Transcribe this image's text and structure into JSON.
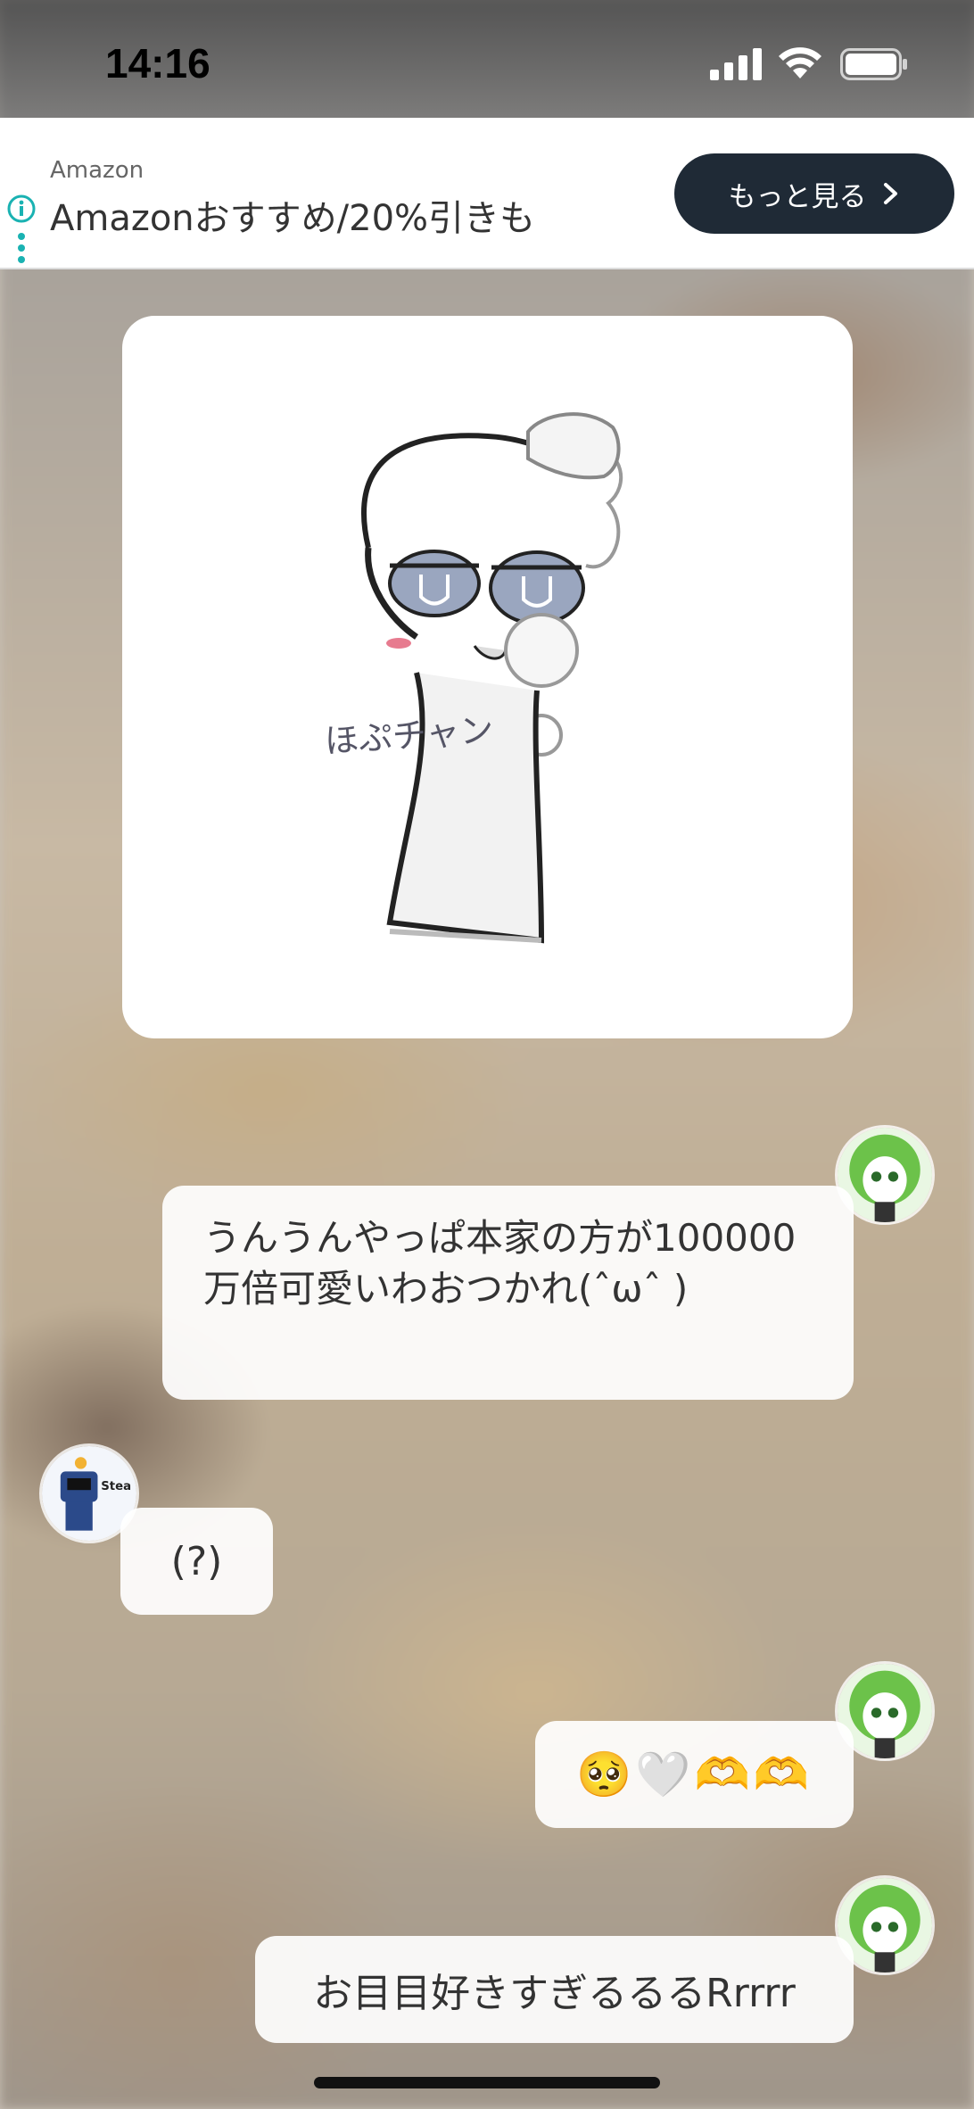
{
  "status_bar": {
    "time": "14:16"
  },
  "ad": {
    "sponsor": "Amazon",
    "title": "Amazonおすすめ/20%引きも",
    "cta_label": "もっと見る"
  },
  "image_card": {
    "handwritten_text": "ほぷチャン"
  },
  "messages": [
    {
      "side": "right",
      "text": "うんうんやっぱ本家の方が100000万倍可愛いわおつかれ(ˆωˆ )"
    },
    {
      "side": "left",
      "text": "(?)",
      "avatar_text": "Stea"
    },
    {
      "side": "right",
      "text": "🥺🤍🫶🫶"
    },
    {
      "side": "right",
      "text": "お目目好きすぎるるるRrrrr"
    }
  ],
  "colors": {
    "ad_button_bg": "#1f2a36",
    "bubble_bg": "#ffffff",
    "avatar_green": "#6cc24a"
  }
}
